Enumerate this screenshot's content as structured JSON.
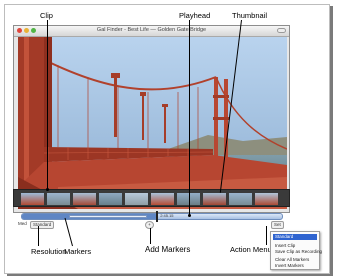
{
  "callouts": {
    "clip": "Clip",
    "playhead": "Playhead",
    "thumbnail": "Thumbnail",
    "resolution": "Resolution",
    "markers": "Markers",
    "add_markers": "Add Markers",
    "action_menu": "Action Menu"
  },
  "window": {
    "title": "Gal Finder - Best Life — Golden Gate Bridge"
  },
  "timeline": {
    "progress": 0.52,
    "playhead_readout": "2:45.15"
  },
  "controls": {
    "resolution_label": "Med",
    "resolution_value": "Standard",
    "action_button": "Set"
  },
  "action_menu": {
    "items": [
      "Standard",
      "Insert Clip",
      "Save Clip as Recording",
      "Clear All Markers",
      "Invert Markers"
    ],
    "selected_index": 0
  },
  "colors": {
    "sky": "#8fb8df",
    "bridge": "#b2402c",
    "water": "#6f8f9c",
    "menu_highlight": "#2f64d0"
  }
}
